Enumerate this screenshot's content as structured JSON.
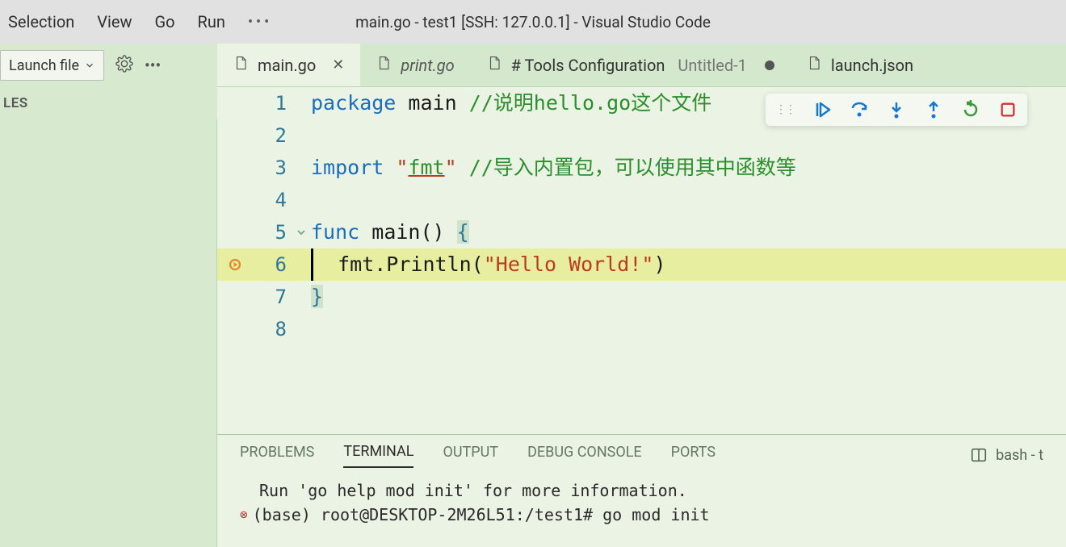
{
  "menu": {
    "selection": "Selection",
    "view": "View",
    "go": "Go",
    "run": "Run"
  },
  "window_title": "main.go - test1 [SSH: 127.0.0.1] - Visual Studio Code",
  "launch_config": {
    "label": "Launch file"
  },
  "sidebar": {
    "section_label": "LES"
  },
  "tabs": [
    {
      "label": "main.go",
      "active": true,
      "close": true
    },
    {
      "label": "print.go",
      "italic": true
    },
    {
      "label": "# Tools Configuration",
      "secondary": "Untitled-1",
      "modified": true
    },
    {
      "label": "launch.json"
    }
  ],
  "code": {
    "lines": [
      {
        "n": "1",
        "segments": [
          {
            "t": "package ",
            "c": "kw"
          },
          {
            "t": "main ",
            "c": "ident"
          },
          {
            "t": "//说明hello.go这个文件",
            "c": "comment"
          }
        ]
      },
      {
        "n": "2",
        "segments": []
      },
      {
        "n": "3",
        "segments": [
          {
            "t": "import ",
            "c": "kw"
          },
          {
            "t": "\"",
            "c": "str"
          },
          {
            "t": "fmt",
            "c": "import-name"
          },
          {
            "t": "\"",
            "c": "str"
          },
          {
            "t": " //导入内置包，可以使用其中函数等",
            "c": "comment"
          }
        ]
      },
      {
        "n": "4",
        "segments": []
      },
      {
        "n": "5",
        "fold": true,
        "segments": [
          {
            "t": "func ",
            "c": "kw"
          },
          {
            "t": "main",
            "c": "ident"
          },
          {
            "t": "()",
            "c": "paren"
          },
          {
            "t": " ",
            "c": ""
          },
          {
            "t": "{",
            "c": "brace"
          }
        ]
      },
      {
        "n": "6",
        "hl": true,
        "bp": true,
        "segments": [
          {
            "t": "  fmt.Println(",
            "c": "ident"
          },
          {
            "t": "\"Hello World!\"",
            "c": "str"
          },
          {
            "t": ")",
            "c": "ident"
          }
        ]
      },
      {
        "n": "7",
        "segments": [
          {
            "t": "}",
            "c": "brace"
          }
        ]
      },
      {
        "n": "8",
        "segments": []
      }
    ]
  },
  "panel": {
    "tabs": {
      "problems": "PROBLEMS",
      "terminal": "TERMINAL",
      "output": "OUTPUT",
      "debug_console": "DEBUG CONSOLE",
      "ports": "PORTS"
    },
    "right_label": "bash - t"
  },
  "terminal": {
    "line1": "Run 'go help mod init' for more information.",
    "prompt": "(base) root@DESKTOP-2M26L51:/test1# ",
    "cmd": "go mod init"
  }
}
